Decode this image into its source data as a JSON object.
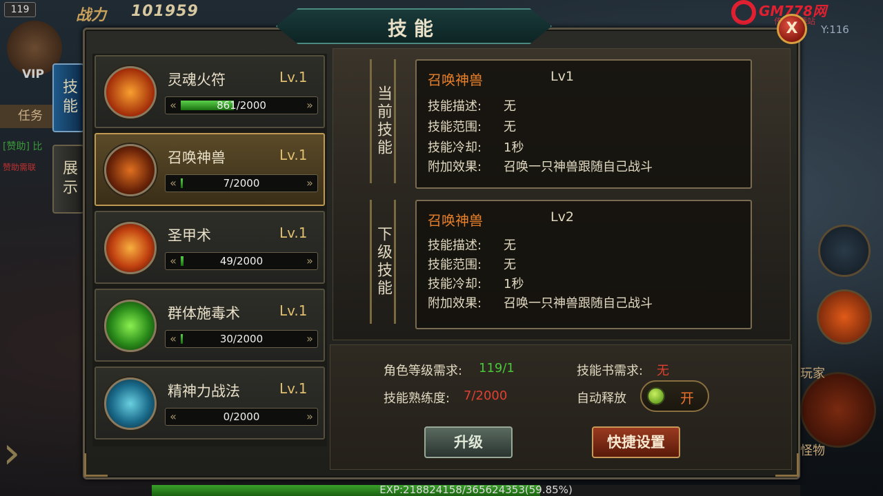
{
  "hud": {
    "level_badge": "119",
    "power_label": "战力",
    "power_value": "101959",
    "vip": "VIP",
    "task": "任务",
    "help_text": "[赞助] 比",
    "help_text2": "赞助需联",
    "coord": "Y:116",
    "player_label": "玩家",
    "monster_label": "怪物",
    "logo_text": "GM778网",
    "logo_sub": "传奇资源站",
    "exp_text": "EXP:218824158/365624353(59.85%)",
    "exp_fraction": 0.5985
  },
  "tabs": {
    "skills": "技能",
    "display": "展示"
  },
  "panel": {
    "title": "技能",
    "close": "X"
  },
  "skills": [
    {
      "name": "灵魂火符",
      "level": "Lv.1",
      "progress": "861/2000",
      "fraction": 0.4305,
      "icon": "fire-talisman-icon"
    },
    {
      "name": "召唤神兽",
      "level": "Lv.1",
      "progress": "7/2000",
      "fraction": 0.0035,
      "icon": "summon-beast-icon"
    },
    {
      "name": "圣甲术",
      "level": "Lv.1",
      "progress": "49/2000",
      "fraction": 0.0245,
      "icon": "holy-armor-icon"
    },
    {
      "name": "群体施毒术",
      "level": "Lv.1",
      "progress": "30/2000",
      "fraction": 0.015,
      "icon": "group-poison-icon"
    },
    {
      "name": "精神力战法",
      "level": "Lv.1",
      "progress": "0/2000",
      "fraction": 0.0,
      "icon": "spirit-warfare-icon"
    }
  ],
  "current": {
    "side_label": "当前技能",
    "title": "召唤神兽",
    "level": "Lv1",
    "desc_label": "技能描述:",
    "desc": "无",
    "range_label": "技能范围:",
    "range": "无",
    "cooldown_label": "技能冷却:",
    "cooldown": "1秒",
    "effect_label": "附加效果:",
    "effect": "召唤一只神兽跟随自己战斗"
  },
  "next": {
    "side_label": "下级技能",
    "title": "召唤神兽",
    "level": "Lv2",
    "desc_label": "技能描述:",
    "desc": "无",
    "range_label": "技能范围:",
    "range": "无",
    "cooldown_label": "技能冷却:",
    "cooldown": "1秒",
    "effect_label": "附加效果:",
    "effect": "召唤一只神兽跟随自己战斗"
  },
  "requirements": {
    "role_level_label": "角色等级需求:",
    "role_level": "119/1",
    "proficiency_label": "技能熟练度:",
    "proficiency": "7/2000",
    "book_label": "技能书需求:",
    "book": "无",
    "auto_label": "自动释放",
    "auto_state": "开"
  },
  "buttons": {
    "upgrade": "升级",
    "quick_set": "快捷设置"
  },
  "colors": {
    "accent_orange": "#e8802a",
    "progress_green": "#4ac83a",
    "requirement_red": "#e04030"
  }
}
